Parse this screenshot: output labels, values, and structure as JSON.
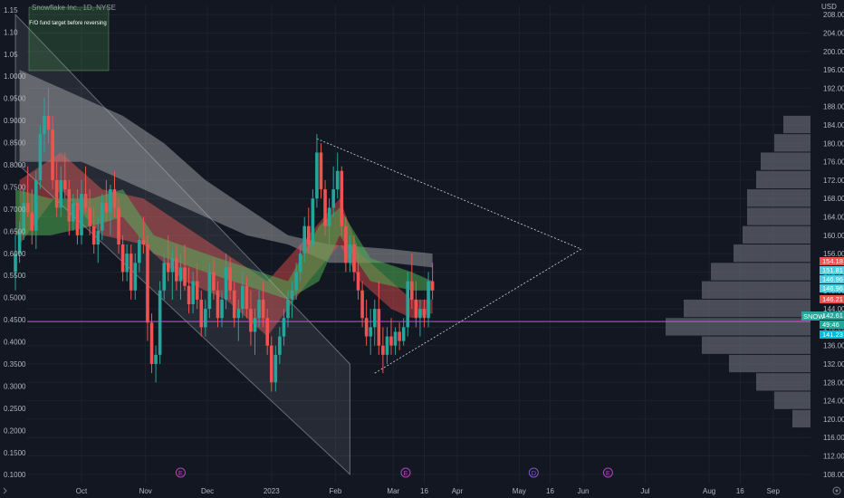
{
  "header": {
    "title": "Snowflake Inc., 1D, NYSE",
    "currency": "USD"
  },
  "note_box": {
    "text": "F/O fund target before reversing"
  },
  "colors": {
    "up": "#26a69a",
    "down": "#ef5350",
    "bg": "#131722",
    "support": "#e040fb",
    "channel": "#b2b5be",
    "volume_profile": "#5d606b"
  },
  "chart_data": {
    "type": "candlestick",
    "title": "Snowflake Inc., 1D, NYSE",
    "ticker": "SNOW",
    "y_axis_right": {
      "ticks": [
        "208.00",
        "204.00",
        "200.00",
        "196.00",
        "192.00",
        "188.00",
        "184.00",
        "180.00",
        "176.00",
        "172.00",
        "168.00",
        "164.00",
        "160.00",
        "156.00",
        "152.00",
        "148.00",
        "144.00",
        "140.00",
        "136.00",
        "132.00",
        "128.00",
        "124.00",
        "120.00",
        "116.00",
        "112.00",
        "108.00"
      ],
      "range": [
        106,
        210
      ]
    },
    "y_axis_left": {
      "ticks": [
        "1.15",
        "1.10",
        "1.05",
        "1.0000",
        "0.9500",
        "0.9000",
        "0.8500",
        "0.8000",
        "0.7500",
        "0.7000",
        "0.6500",
        "0.6000",
        "0.5500",
        "0.5000",
        "0.4500",
        "0.4000",
        "0.3500",
        "0.3000",
        "0.2500",
        "0.2000",
        "0.1500",
        "0.1000"
      ],
      "range": [
        0.08,
        1.16
      ]
    },
    "x_axis": {
      "ticks": [
        "Oct",
        "Nov",
        "Dec",
        "2023",
        "Feb",
        "Mar",
        "16",
        "Apr",
        "May",
        "16",
        "Jun",
        "Jul",
        "Aug",
        "16",
        "Sep"
      ],
      "tick_days": [
        0,
        31,
        61,
        92,
        123,
        151,
        166,
        182,
        212,
        227,
        243,
        273,
        304,
        319,
        335
      ],
      "start_date": "2022-10-01"
    },
    "price_labels": [
      {
        "value": "154.18",
        "color": "#ef5350"
      },
      {
        "value": "151.81",
        "color": "#4dd0e1"
      },
      {
        "value": "146.96",
        "color": "#4dd0e1"
      },
      {
        "value": "146.96",
        "color": "#4dd0e1"
      },
      {
        "value": "146.21",
        "color": "#ef5350"
      },
      {
        "value": "142.61",
        "color": "#26a69a"
      },
      {
        "value": "49:46",
        "color": "#26a69a"
      },
      {
        "value": "141.23",
        "color": "#00bcd4"
      }
    ],
    "last_price_tag": "SNOW",
    "support_level": 141.23,
    "event_markers": [
      {
        "day": 48,
        "label": "E"
      },
      {
        "day": 157,
        "label": "E"
      },
      {
        "day": 219,
        "label": "D"
      },
      {
        "day": 255,
        "label": "E"
      }
    ],
    "candles": [
      [
        -32,
        152,
        160,
        148,
        156
      ],
      [
        -30,
        156,
        163,
        154,
        161
      ],
      [
        -28,
        161,
        170,
        159,
        167
      ],
      [
        -26,
        167,
        175,
        164,
        165
      ],
      [
        -24,
        165,
        170,
        158,
        161
      ],
      [
        -22,
        161,
        174,
        157,
        172
      ],
      [
        -20,
        172,
        184,
        170,
        182
      ],
      [
        -18,
        182,
        190,
        178,
        186
      ],
      [
        -16,
        186,
        192,
        180,
        183
      ],
      [
        -14,
        183,
        186,
        170,
        172
      ],
      [
        -12,
        172,
        176,
        164,
        166
      ],
      [
        -10,
        166,
        175,
        164,
        172
      ],
      [
        -8,
        172,
        178,
        168,
        170
      ],
      [
        -6,
        170,
        172,
        160,
        163
      ],
      [
        -4,
        163,
        169,
        161,
        167
      ],
      [
        -2,
        167,
        170,
        158,
        160
      ],
      [
        0,
        160,
        172,
        158,
        169
      ],
      [
        2,
        169,
        175,
        165,
        166
      ],
      [
        4,
        166,
        170,
        160,
        162
      ],
      [
        6,
        162,
        166,
        156,
        158
      ],
      [
        8,
        158,
        164,
        154,
        161
      ],
      [
        10,
        161,
        169,
        159,
        167
      ],
      [
        12,
        167,
        172,
        163,
        165
      ],
      [
        14,
        165,
        171,
        160,
        170
      ],
      [
        16,
        170,
        174,
        164,
        166
      ],
      [
        18,
        166,
        168,
        156,
        158
      ],
      [
        20,
        158,
        160,
        150,
        152
      ],
      [
        22,
        152,
        158,
        150,
        156
      ],
      [
        24,
        156,
        158,
        146,
        148
      ],
      [
        26,
        148,
        156,
        146,
        154
      ],
      [
        28,
        154,
        160,
        152,
        159
      ],
      [
        30,
        159,
        164,
        156,
        158
      ],
      [
        32,
        158,
        160,
        137,
        141
      ],
      [
        34,
        141,
        143,
        130,
        132
      ],
      [
        36,
        132,
        136,
        128,
        134
      ],
      [
        38,
        134,
        150,
        132,
        148
      ],
      [
        40,
        148,
        156,
        146,
        154
      ],
      [
        42,
        154,
        160,
        150,
        152
      ],
      [
        44,
        152,
        157,
        146,
        155
      ],
      [
        46,
        155,
        158,
        148,
        150
      ],
      [
        48,
        150,
        156,
        146,
        153
      ],
      [
        50,
        153,
        158,
        148,
        149
      ],
      [
        52,
        149,
        153,
        143,
        145
      ],
      [
        54,
        145,
        152,
        143,
        150
      ],
      [
        56,
        150,
        154,
        144,
        146
      ],
      [
        58,
        146,
        148,
        138,
        140
      ],
      [
        60,
        140,
        146,
        138,
        144
      ],
      [
        62,
        144,
        154,
        142,
        152
      ],
      [
        64,
        152,
        155,
        146,
        148
      ],
      [
        66,
        148,
        150,
        140,
        142
      ],
      [
        68,
        142,
        148,
        140,
        146
      ],
      [
        70,
        146,
        156,
        144,
        153
      ],
      [
        72,
        153,
        155,
        146,
        148
      ],
      [
        74,
        148,
        150,
        140,
        142
      ],
      [
        76,
        142,
        146,
        137,
        144
      ],
      [
        78,
        144,
        152,
        142,
        149
      ],
      [
        80,
        149,
        151,
        142,
        144
      ],
      [
        82,
        144,
        148,
        136,
        139
      ],
      [
        84,
        139,
        144,
        134,
        142
      ],
      [
        86,
        142,
        148,
        140,
        146
      ],
      [
        88,
        146,
        150,
        140,
        142
      ],
      [
        90,
        142,
        144,
        134,
        136
      ],
      [
        92,
        136,
        138,
        126,
        128
      ],
      [
        94,
        128,
        136,
        126,
        134
      ],
      [
        96,
        134,
        140,
        132,
        138
      ],
      [
        98,
        138,
        144,
        136,
        142
      ],
      [
        100,
        142,
        148,
        140,
        146
      ],
      [
        102,
        146,
        150,
        142,
        148
      ],
      [
        104,
        148,
        154,
        146,
        152
      ],
      [
        106,
        152,
        158,
        150,
        156
      ],
      [
        108,
        156,
        164,
        154,
        162
      ],
      [
        110,
        162,
        166,
        156,
        158
      ],
      [
        112,
        158,
        170,
        156,
        168
      ],
      [
        114,
        168,
        182,
        166,
        178
      ],
      [
        116,
        178,
        180,
        168,
        170
      ],
      [
        118,
        170,
        172,
        160,
        162
      ],
      [
        120,
        162,
        168,
        158,
        166
      ],
      [
        122,
        166,
        175,
        164,
        170
      ],
      [
        124,
        170,
        178,
        168,
        174
      ],
      [
        126,
        174,
        175,
        160,
        162
      ],
      [
        128,
        162,
        164,
        152,
        154
      ],
      [
        130,
        154,
        160,
        152,
        158
      ],
      [
        132,
        158,
        160,
        150,
        152
      ],
      [
        134,
        152,
        156,
        146,
        148
      ],
      [
        136,
        148,
        150,
        140,
        142
      ],
      [
        138,
        142,
        146,
        136,
        138
      ],
      [
        140,
        138,
        144,
        134,
        140
      ],
      [
        142,
        140,
        146,
        136,
        144
      ],
      [
        144,
        144,
        150,
        134,
        136
      ],
      [
        146,
        136,
        140,
        130,
        134
      ],
      [
        148,
        134,
        140,
        132,
        138
      ],
      [
        150,
        138,
        142,
        134,
        136
      ],
      [
        152,
        136,
        140,
        134,
        139
      ],
      [
        154,
        139,
        141,
        135,
        137
      ],
      [
        156,
        137,
        142,
        136,
        140
      ],
      [
        158,
        140,
        152,
        138,
        150
      ],
      [
        160,
        150,
        156,
        144,
        146
      ],
      [
        162,
        146,
        150,
        140,
        142
      ],
      [
        164,
        142,
        146,
        138,
        144
      ],
      [
        166,
        144,
        146,
        140,
        142
      ],
      [
        168,
        142,
        152,
        140,
        150
      ],
      [
        170,
        150,
        154,
        146,
        148
      ]
    ],
    "series": [
      {
        "name": "",
        "color": "#4dd0e1",
        "values": []
      }
    ]
  }
}
